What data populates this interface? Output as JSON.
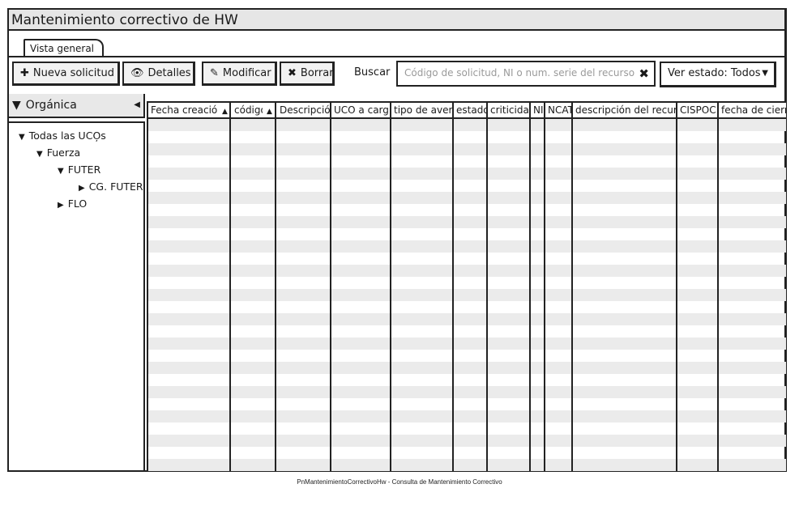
{
  "window": {
    "title": "Mantenimiento correctivo de HW"
  },
  "tabs": [
    {
      "label": "Vista general"
    }
  ],
  "toolbar": {
    "new_label": "Nueva solicitud",
    "details_label": "Detalles",
    "modify_label": "Modificar",
    "delete_label": "Borrar",
    "search_label": "Buscar",
    "search_placeholder": "Código de solicitud, NI o num. serie del recurso",
    "search_value": "",
    "state_filter": "Ver estado: Todos"
  },
  "icons": {
    "new": "plus-icon",
    "details": "eye-icon",
    "modify": "edit-icon",
    "delete": "x-icon",
    "filter": "funnel-icon",
    "clear": "x-icon",
    "dropdown": "caret-down-icon"
  },
  "sidebar": {
    "title": "Orgánica",
    "tree": [
      {
        "label": "Todas las UCO̦s",
        "expanded": true
      },
      {
        "label": "Fuerza",
        "expanded": true
      },
      {
        "label": "FUTER",
        "expanded": true
      },
      {
        "label": "CG. FUTER",
        "expanded": false
      },
      {
        "label": "FLO",
        "expanded": false
      }
    ]
  },
  "table": {
    "columns": [
      {
        "label": "Fecha creación",
        "sort": "asc"
      },
      {
        "label": "código",
        "sort": "asc"
      },
      {
        "label": "Descripción"
      },
      {
        "label": "UCO a cargo"
      },
      {
        "label": "tipo de avería"
      },
      {
        "label": "estado"
      },
      {
        "label": "criticidad"
      },
      {
        "label": "NI"
      },
      {
        "label": "NCAT"
      },
      {
        "label": "descripción del recurso"
      },
      {
        "label": "CISPOC"
      },
      {
        "label": "fecha de cierre"
      }
    ],
    "rows": []
  },
  "footer": {
    "caption": "PnMantenimientoCorrectivoHw - Consulta de Mantenimiento Correctivo"
  },
  "colors": {
    "frame": "#222222",
    "header_bg": "#e6e6e6",
    "row_alt": "#ebebeb"
  }
}
